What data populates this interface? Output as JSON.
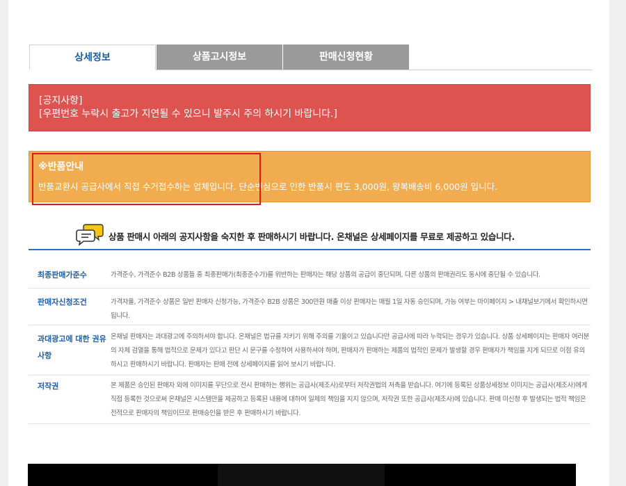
{
  "tabs": [
    {
      "label": "상세정보",
      "active": true
    },
    {
      "label": "상품고시정보",
      "active": false
    },
    {
      "label": "판매신청현황",
      "active": false
    }
  ],
  "notice": {
    "line1": "[공지사항]",
    "line2": "[우편번호 누락시 출고가 지연될 수 있으니 발주시 주의 하시기 바랍니다.]"
  },
  "returns": {
    "title": "※반품안내",
    "body": "반품교환시 공급사에서 직접 수거접수하는 업체입니다. 단순변심으로 인한 반품시 편도 3,000원, 왕복배송비 6,000원 입니다."
  },
  "banner": {
    "text": "상품 판매시 아래의 공지사항을 숙지한 후 판매하시기 바랍니다. 온채널은 상세페이지를 무료로 제공하고 있습니다."
  },
  "policy": [
    {
      "label": "최종판매가준수",
      "desc": "가격준수, 가격준수 B2B 상품들 중 최종판매가(최종준수가)를 위반하는 판매자는 해당 상품의 공급이 중단되며, 다른 상품의 판매권리도 동시에 중단될 수 있습니다."
    },
    {
      "label": "판매자신청조건",
      "desc": "가격자율, 가격준수 상품은 일반 판매자 신청가능, 가격준수 B2B 상품은 300만원 매출 이상 판매자는 매월 1일 자동 승인되며, 가능 여부는 마이페이지 > 내채널보기에서 확인하시면 됩니다."
    },
    {
      "label": "과대광고에 대한 권유사항",
      "desc": "온채널 판매자는 과대광고에 주의하셔야 합니다. 온채널은 법규를 지키기 위해 주의를 기울이고 있습니다만 공급사에 따라 누락되는 경우가 있습니다. 상품 상세페이지는 판매자 여러분의 자체 검열을 통해 법적으로 문제가 있다고 판단 시 문구를 수정하여 사용하셔야 하며, 판매자가 판매하는 제품의 법적인 문제가 발생할 경우 판매자가 책임을 지게 되므로 이점 유의하시고 판매하시기 바랍니다. 판매자는 판매 전에 상세페이지를 읽어 보시기 바랍니다."
    },
    {
      "label": "저작권",
      "desc": "본 제품은 승인된 판매자 외에 이미지를 무단으로 전시 판매하는 행위는 공급사(제조사)로부터 저작권법의 저촉을 받습니다. 여기에 등록된 상품상세정보 이미지는 공급사(제조사)에게 직접 등록한 것으로써 온채널은 시스템만을 제공하고 등록된 내용에 대하여 일체의 책임을 지지 않으며, 저작권 또한 공급사(제조사)에 있습니다. 판매 미신청 후 발생되는 법적 책임은 전적으로 판매자의 책임이므로 판매승인을 받은 후 판매하시기 바랍니다."
    }
  ],
  "colors": {
    "notice_bg": "#dc5350",
    "returns_bg": "#f0ac4e",
    "accent_blue": "#2f6fc0",
    "highlight_red": "#e01818"
  }
}
